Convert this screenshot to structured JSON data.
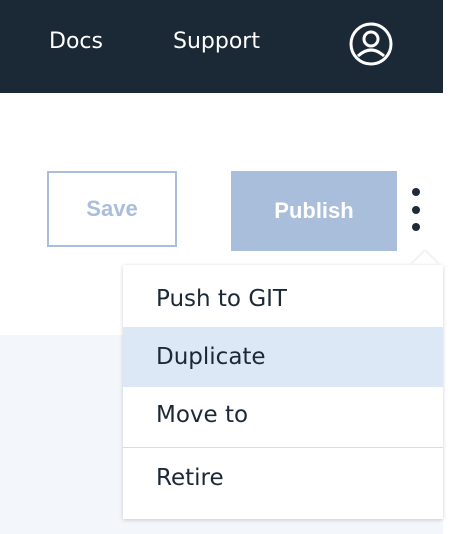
{
  "nav": {
    "links": [
      {
        "label": "Docs"
      },
      {
        "label": "Support"
      }
    ],
    "avatar_icon": "user-avatar-icon"
  },
  "toolbar": {
    "save_label": "Save",
    "publish_label": "Publish",
    "overflow_icon": "kebab-menu-icon"
  },
  "menu": {
    "items": [
      {
        "label": "Push to GIT"
      },
      {
        "label": "Duplicate"
      },
      {
        "label": "Move to"
      },
      {
        "label": "Retire"
      }
    ],
    "highlighted_item": "Duplicate"
  },
  "colors": {
    "topbar": "#1b2835",
    "accent_disabled": "#a9bedb",
    "menu_highlight": "#dce8f6",
    "page_background": "#f3f6fa"
  }
}
